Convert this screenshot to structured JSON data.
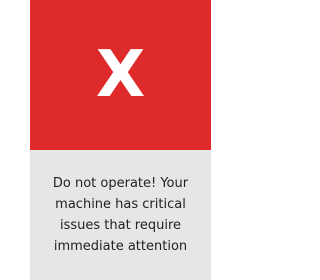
{
  "alert": {
    "symbol": "X",
    "icon": "x-icon",
    "header_color": "#de2a2a",
    "message": "Do not operate! Your machine has critical issues that require immediate attention",
    "body_color": "#e6e6e6"
  }
}
